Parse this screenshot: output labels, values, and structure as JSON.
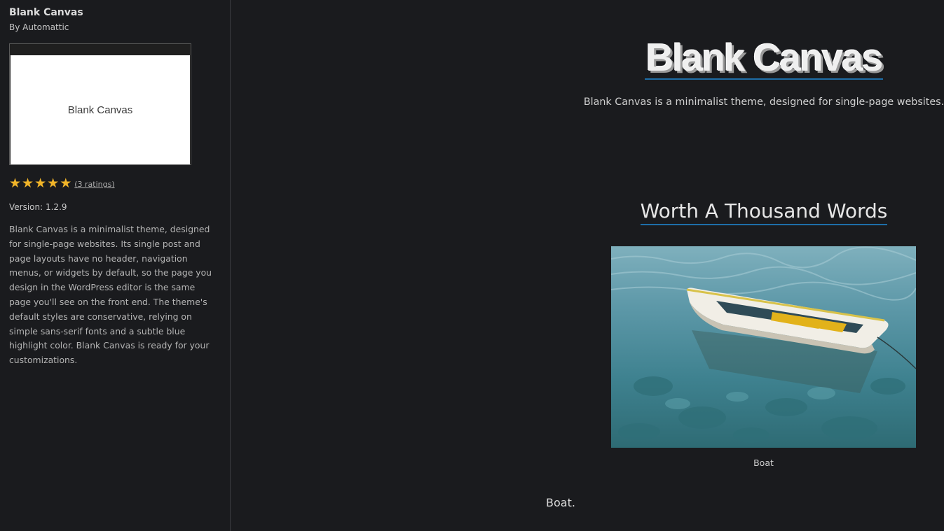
{
  "sidebar": {
    "theme_name": "Blank Canvas",
    "author": "By Automattic",
    "screenshot_label": "Blank Canvas",
    "rating": {
      "stars": 5,
      "max": 5,
      "link_text": "(3 ratings)"
    },
    "version": "Version: 1.2.9",
    "description": "Blank Canvas is a minimalist theme, designed for single-page websites. Its single post and page layouts have no header, navigation menus, or widgets by default, so the page you design in the WordPress editor is the same page you'll see on the front end. The theme's default styles are conservative, relying on simple sans-serif fonts and a subtle blue highlight color. Blank Canvas is ready for your customizations."
  },
  "preview": {
    "site_title": "Blank Canvas",
    "tagline": "Blank Canvas is a minimalist theme, designed for single-page websites.",
    "heading": "Worth A Thousand Words",
    "image_caption": "Boat",
    "body_text": "Boat."
  },
  "colors": {
    "background": "#1a1b1e",
    "accent": "#1e6ea8",
    "star": "#f0b429"
  }
}
